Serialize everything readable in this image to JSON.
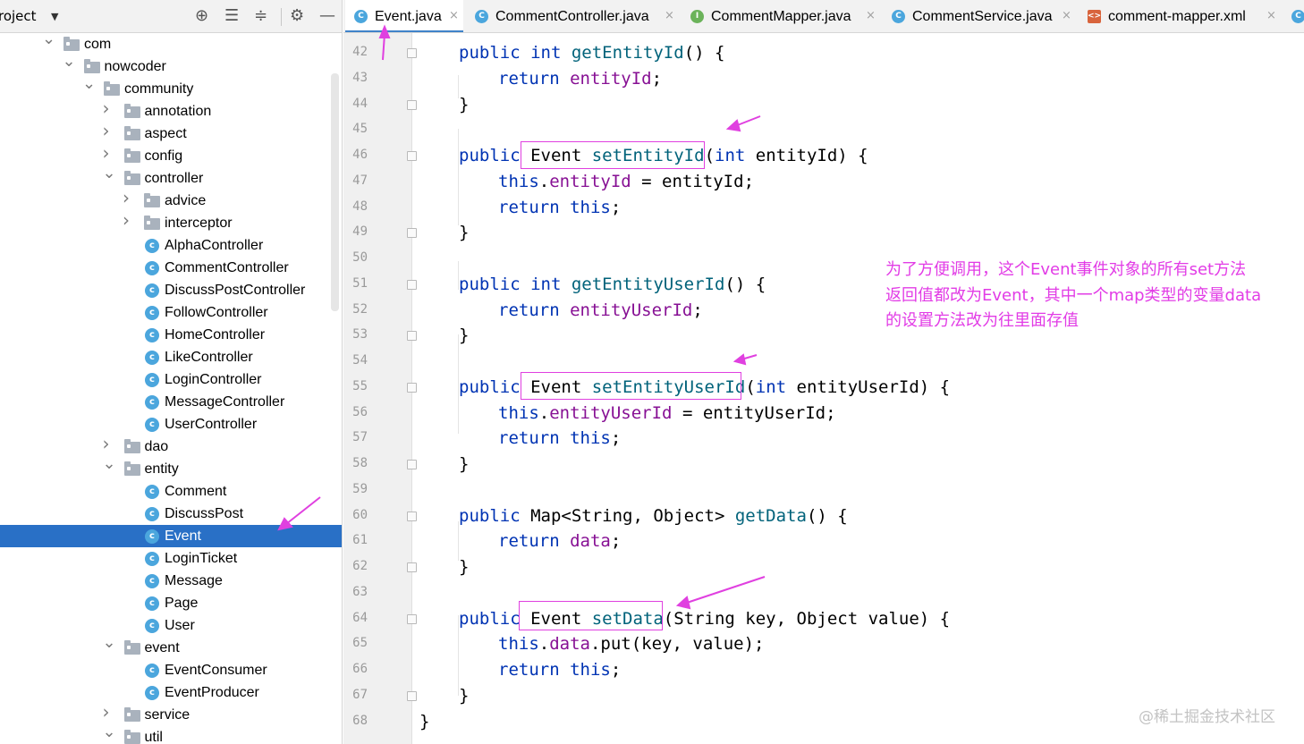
{
  "project_panel": {
    "title": "roject",
    "dropdown_icon": "triangle-down",
    "toolbar_icons": [
      "crosshair-icon",
      "expand-all-icon",
      "collapse-all-icon",
      "gear-icon",
      "minimize-icon"
    ]
  },
  "tree": [
    {
      "label": "com",
      "type": "folder",
      "depth": 0,
      "expanded": true
    },
    {
      "label": "nowcoder",
      "type": "folder",
      "depth": 1,
      "expanded": true
    },
    {
      "label": "community",
      "type": "folder",
      "depth": 2,
      "expanded": true
    },
    {
      "label": "annotation",
      "type": "folder",
      "depth": 3,
      "expanded": false
    },
    {
      "label": "aspect",
      "type": "folder",
      "depth": 3,
      "expanded": false
    },
    {
      "label": "config",
      "type": "folder",
      "depth": 3,
      "expanded": false
    },
    {
      "label": "controller",
      "type": "folder",
      "depth": 3,
      "expanded": true
    },
    {
      "label": "advice",
      "type": "folder",
      "depth": 4,
      "expanded": false
    },
    {
      "label": "interceptor",
      "type": "folder",
      "depth": 4,
      "expanded": false
    },
    {
      "label": "AlphaController",
      "type": "class",
      "depth": 4
    },
    {
      "label": "CommentController",
      "type": "class",
      "depth": 4
    },
    {
      "label": "DiscussPostController",
      "type": "class",
      "depth": 4
    },
    {
      "label": "FollowController",
      "type": "class",
      "depth": 4
    },
    {
      "label": "HomeController",
      "type": "class",
      "depth": 4
    },
    {
      "label": "LikeController",
      "type": "class",
      "depth": 4
    },
    {
      "label": "LoginController",
      "type": "class",
      "depth": 4
    },
    {
      "label": "MessageController",
      "type": "class",
      "depth": 4
    },
    {
      "label": "UserController",
      "type": "class",
      "depth": 4
    },
    {
      "label": "dao",
      "type": "folder",
      "depth": 3,
      "expanded": false
    },
    {
      "label": "entity",
      "type": "folder",
      "depth": 3,
      "expanded": true
    },
    {
      "label": "Comment",
      "type": "class",
      "depth": 4
    },
    {
      "label": "DiscussPost",
      "type": "class",
      "depth": 4
    },
    {
      "label": "Event",
      "type": "class",
      "depth": 4,
      "selected": true
    },
    {
      "label": "LoginTicket",
      "type": "class",
      "depth": 4
    },
    {
      "label": "Message",
      "type": "class",
      "depth": 4
    },
    {
      "label": "Page",
      "type": "class",
      "depth": 4
    },
    {
      "label": "User",
      "type": "class",
      "depth": 4
    },
    {
      "label": "event",
      "type": "folder",
      "depth": 3,
      "expanded": true
    },
    {
      "label": "EventConsumer",
      "type": "class",
      "depth": 4
    },
    {
      "label": "EventProducer",
      "type": "class",
      "depth": 4
    },
    {
      "label": "service",
      "type": "folder",
      "depth": 3,
      "expanded": false
    },
    {
      "label": "util",
      "type": "folder",
      "depth": 3,
      "expanded": true
    }
  ],
  "tabs": [
    {
      "label": "Event.java",
      "icon": "C",
      "kind": "c",
      "active": true
    },
    {
      "label": "CommentController.java",
      "icon": "C",
      "kind": "c"
    },
    {
      "label": "CommentMapper.java",
      "icon": "I",
      "kind": "i"
    },
    {
      "label": "CommentService.java",
      "icon": "C",
      "kind": "c"
    },
    {
      "label": "comment-mapper.xml",
      "icon": "<>",
      "kind": "xml"
    },
    {
      "label": "",
      "icon": "C",
      "kind": "c"
    }
  ],
  "tab_close_glyph": "×",
  "code_lines": [
    {
      "num": "42",
      "tokens": [
        [
          "kw",
          "public "
        ],
        [
          "kw",
          "int "
        ],
        [
          "fn",
          "getEntityId"
        ],
        [
          "",
          "() {"
        ]
      ]
    },
    {
      "num": "43",
      "tokens": [
        [
          "kw",
          "return "
        ],
        [
          "fld",
          "entityId"
        ],
        [
          "",
          ";"
        ]
      ]
    },
    {
      "num": "44",
      "tokens": [
        [
          "",
          "}"
        ]
      ]
    },
    {
      "num": "45",
      "tokens": []
    },
    {
      "num": "46",
      "tokens": [
        [
          "kw",
          "public "
        ],
        [
          "",
          "Event "
        ],
        [
          "fn",
          "setEntityId"
        ],
        [
          "",
          "("
        ],
        [
          "kw",
          "int "
        ],
        [
          "",
          "entityId) {"
        ]
      ]
    },
    {
      "num": "47",
      "tokens": [
        [
          "kw",
          "this"
        ],
        [
          "",
          "."
        ],
        [
          "fld",
          "entityId"
        ],
        [
          "",
          " = entityId;"
        ]
      ]
    },
    {
      "num": "48",
      "tokens": [
        [
          "kw",
          "return "
        ],
        [
          "kw",
          "this"
        ],
        [
          "",
          ";"
        ]
      ]
    },
    {
      "num": "49",
      "tokens": [
        [
          "",
          "}"
        ]
      ]
    },
    {
      "num": "50",
      "tokens": []
    },
    {
      "num": "51",
      "tokens": [
        [
          "kw",
          "public "
        ],
        [
          "kw",
          "int "
        ],
        [
          "fn",
          "getEntityUserId"
        ],
        [
          "",
          "() {"
        ]
      ]
    },
    {
      "num": "52",
      "tokens": [
        [
          "kw",
          "return "
        ],
        [
          "fld",
          "entityUserId"
        ],
        [
          "",
          ";"
        ]
      ]
    },
    {
      "num": "53",
      "tokens": [
        [
          "",
          "}"
        ]
      ]
    },
    {
      "num": "54",
      "tokens": []
    },
    {
      "num": "55",
      "tokens": [
        [
          "kw",
          "public "
        ],
        [
          "",
          "Event "
        ],
        [
          "fn",
          "setEntityUserId"
        ],
        [
          "",
          "("
        ],
        [
          "kw",
          "int "
        ],
        [
          "",
          "entityUserId) {"
        ]
      ]
    },
    {
      "num": "56",
      "tokens": [
        [
          "kw",
          "this"
        ],
        [
          "",
          "."
        ],
        [
          "fld",
          "entityUserId"
        ],
        [
          "",
          " = entityUserId;"
        ]
      ]
    },
    {
      "num": "57",
      "tokens": [
        [
          "kw",
          "return "
        ],
        [
          "kw",
          "this"
        ],
        [
          "",
          ";"
        ]
      ]
    },
    {
      "num": "58",
      "tokens": [
        [
          "",
          "}"
        ]
      ]
    },
    {
      "num": "59",
      "tokens": []
    },
    {
      "num": "60",
      "tokens": [
        [
          "kw",
          "public "
        ],
        [
          "",
          "Map<String, Object> "
        ],
        [
          "fn",
          "getData"
        ],
        [
          "",
          "() {"
        ]
      ]
    },
    {
      "num": "61",
      "tokens": [
        [
          "kw",
          "return "
        ],
        [
          "fld",
          "data"
        ],
        [
          "",
          ";"
        ]
      ]
    },
    {
      "num": "62",
      "tokens": [
        [
          "",
          "}"
        ]
      ]
    },
    {
      "num": "63",
      "tokens": []
    },
    {
      "num": "64",
      "tokens": [
        [
          "kw",
          "public "
        ],
        [
          "",
          "Event "
        ],
        [
          "fn",
          "setData"
        ],
        [
          "",
          "(String key, Object value) {"
        ]
      ]
    },
    {
      "num": "65",
      "tokens": [
        [
          "kw",
          "this"
        ],
        [
          "",
          "."
        ],
        [
          "fld",
          "data"
        ],
        [
          "",
          ".put(key, value);"
        ]
      ]
    },
    {
      "num": "66",
      "tokens": [
        [
          "kw",
          "return "
        ],
        [
          "kw",
          "this"
        ],
        [
          "",
          ";"
        ]
      ]
    },
    {
      "num": "67",
      "tokens": [
        [
          "",
          "}"
        ]
      ]
    },
    {
      "num": "68",
      "tokens": [
        [
          "",
          "}"
        ]
      ]
    }
  ],
  "annotation": {
    "line1": "为了方便调用，这个Event事件对象的所有set方法",
    "line2": "返回值都改为Event，其中一个map类型的变量data",
    "line3": "的设置方法改为往里面存值"
  },
  "watermark": "@稀土掘金技术社区",
  "colors": {
    "keyword": "#0033b3",
    "method": "#00627a",
    "field": "#871094",
    "annotation": "#e23ce6",
    "selection": "#2970c6"
  }
}
